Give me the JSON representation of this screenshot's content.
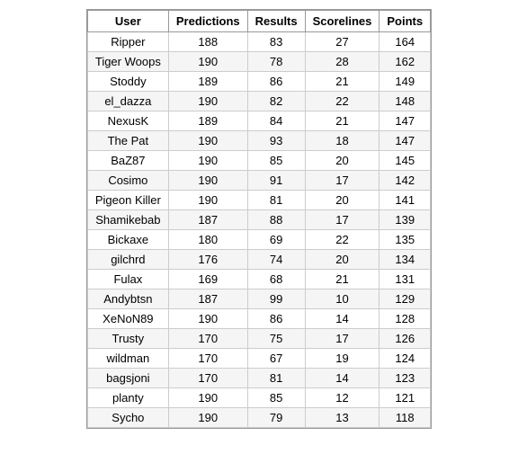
{
  "table": {
    "headers": [
      "User",
      "Predictions",
      "Results",
      "Scorelines",
      "Points"
    ],
    "rows": [
      [
        "Ripper",
        "188",
        "83",
        "27",
        "164"
      ],
      [
        "Tiger Woops",
        "190",
        "78",
        "28",
        "162"
      ],
      [
        "Stoddy",
        "189",
        "86",
        "21",
        "149"
      ],
      [
        "el_dazza",
        "190",
        "82",
        "22",
        "148"
      ],
      [
        "NexusK",
        "189",
        "84",
        "21",
        "147"
      ],
      [
        "The Pat",
        "190",
        "93",
        "18",
        "147"
      ],
      [
        "BaZ87",
        "190",
        "85",
        "20",
        "145"
      ],
      [
        "Cosimo",
        "190",
        "91",
        "17",
        "142"
      ],
      [
        "Pigeon Killer",
        "190",
        "81",
        "20",
        "141"
      ],
      [
        "Shamikebab",
        "187",
        "88",
        "17",
        "139"
      ],
      [
        "Bickaxe",
        "180",
        "69",
        "22",
        "135"
      ],
      [
        "gilchrd",
        "176",
        "74",
        "20",
        "134"
      ],
      [
        "Fulax",
        "169",
        "68",
        "21",
        "131"
      ],
      [
        "Andybtsn",
        "187",
        "99",
        "10",
        "129"
      ],
      [
        "XeNoN89",
        "190",
        "86",
        "14",
        "128"
      ],
      [
        "Trusty",
        "170",
        "75",
        "17",
        "126"
      ],
      [
        "wildman",
        "170",
        "67",
        "19",
        "124"
      ],
      [
        "bagsjoni",
        "170",
        "81",
        "14",
        "123"
      ],
      [
        "planty",
        "190",
        "85",
        "12",
        "121"
      ],
      [
        "Sycho",
        "190",
        "79",
        "13",
        "118"
      ]
    ]
  }
}
